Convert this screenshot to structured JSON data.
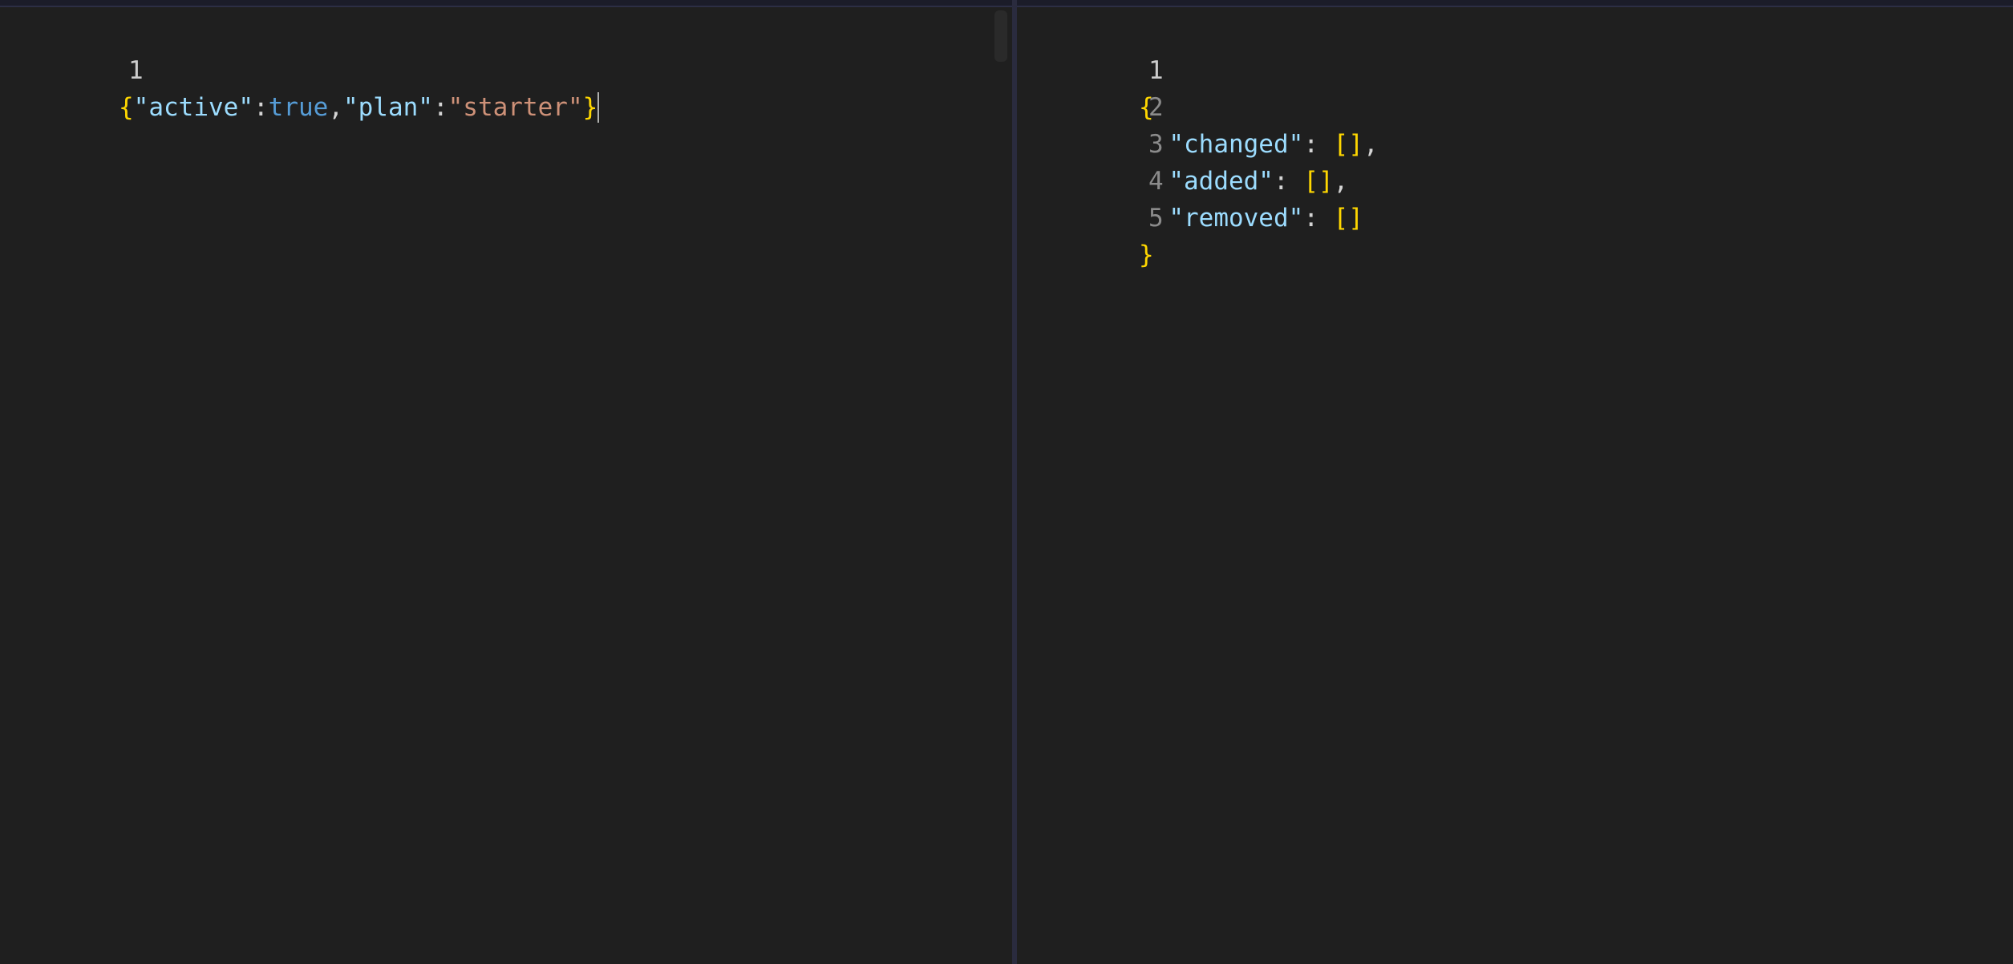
{
  "left_editor": {
    "lines": [
      {
        "number": "1",
        "open_brace": "{",
        "key1": "\"active\"",
        "colon1": ":",
        "value1": "true",
        "comma1": ",",
        "key2": "\"plan\"",
        "colon2": ":",
        "value2": "\"starter\"",
        "close_brace": "}"
      }
    ]
  },
  "right_editor": {
    "lines": [
      {
        "number": "1",
        "text": "{"
      },
      {
        "number": "2",
        "key": "\"changed\"",
        "colon": ": ",
        "value": "[]",
        "trail": ","
      },
      {
        "number": "3",
        "key": "\"added\"",
        "colon": ": ",
        "value": "[]",
        "trail": ","
      },
      {
        "number": "4",
        "key": "\"removed\"",
        "colon": ": ",
        "value": "[]",
        "trail": ""
      },
      {
        "number": "5",
        "text": "}"
      }
    ]
  },
  "colors": {
    "background": "#1f1f1f",
    "brace": "#ffd700",
    "key": "#9cdcfe",
    "boolean": "#569cd6",
    "string": "#ce9178"
  }
}
